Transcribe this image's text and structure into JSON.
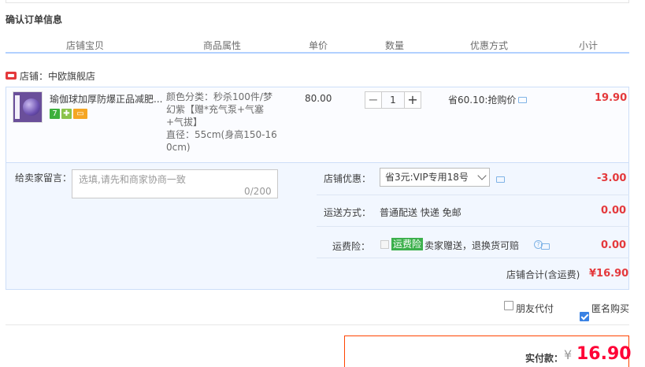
{
  "section_title": "确认订单信息",
  "headers": {
    "item": "店铺宝贝",
    "attr": "商品属性",
    "price": "单价",
    "qty": "数量",
    "discount": "优惠方式",
    "subtotal": "小计"
  },
  "shop": {
    "label": "店铺：中欧旗舰店"
  },
  "item": {
    "title": "瑜伽球加厚防爆正品减肥...",
    "attr_lines": [
      "颜色分类：秒杀100件/梦",
      "幻紫【赠*充气泵+气塞",
      "+气拔】",
      "直径：55cm(身高150-16",
      "0cm)"
    ],
    "price": "80.00",
    "qty": "1",
    "qty_minus": "−",
    "qty_plus": "+",
    "discount": "省60.10:抢购价",
    "subtotal": "19.90"
  },
  "message": {
    "label": "给卖家留言：",
    "placeholder": "选填,请先和商家协商一致",
    "counter": "0/200"
  },
  "shop_discount": {
    "label": "店铺优惠：",
    "selected": "省3元:VIP专用18号",
    "amount": "-3.00"
  },
  "shipping": {
    "label": "运送方式：",
    "value": "普通配送 快递 免邮",
    "amount": "0.00"
  },
  "insurance": {
    "label": "运费险：",
    "tag": "运费险",
    "desc": "卖家赠送，退换货可赔",
    "amount": "0.00"
  },
  "shop_total": {
    "label": "店铺合计(含运费)",
    "value": "¥16.90"
  },
  "options": {
    "friend_pay": "朋友代付",
    "friend_pay_checked": false,
    "anonymous": "匿名购买",
    "anonymous_checked": true
  },
  "payment": {
    "label": "实付款：",
    "currency": "¥",
    "amount": "16.90"
  },
  "colors": {
    "accent_red": "#e4393c",
    "pay_red": "#ff0036",
    "header_line": "#b2d1ff",
    "light_blue_bg": "#f2f7ff"
  }
}
